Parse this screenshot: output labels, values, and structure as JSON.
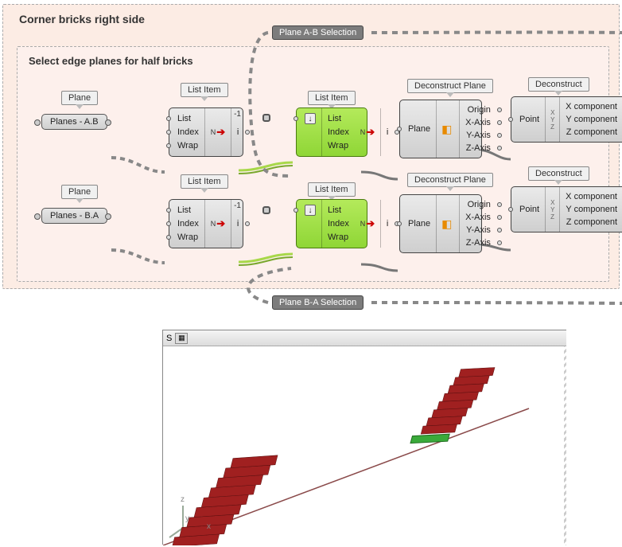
{
  "group": {
    "outer_title": "Corner bricks right side",
    "inner_title": "Select edge planes for half bricks",
    "pill_ab": "Plane A-B Selection",
    "pill_ba": "Plane B-A Selection"
  },
  "labels": {
    "plane": "Plane",
    "list_item": "List Item",
    "deconstruct_plane": "Deconstruct Plane",
    "deconstruct": "Deconstruct"
  },
  "params": {
    "planes_ab": "Planes - A.B",
    "planes_ba": "Planes - B.A"
  },
  "list_item": {
    "inputs": [
      "List",
      "Index",
      "Wrap"
    ],
    "outputs": [
      "i"
    ],
    "badge": "-1"
  },
  "decon_plane": {
    "inputs": [
      "Plane"
    ],
    "outputs": [
      "Origin",
      "X-Axis",
      "Y-Axis",
      "Z-Axis"
    ]
  },
  "decon_pt": {
    "inputs": [
      "Point"
    ],
    "outputs": [
      "X component",
      "Y component",
      "Z component"
    ]
  },
  "viewport": {
    "title": "S",
    "axes": {
      "x": "x",
      "y": "y",
      "z": "z"
    }
  }
}
